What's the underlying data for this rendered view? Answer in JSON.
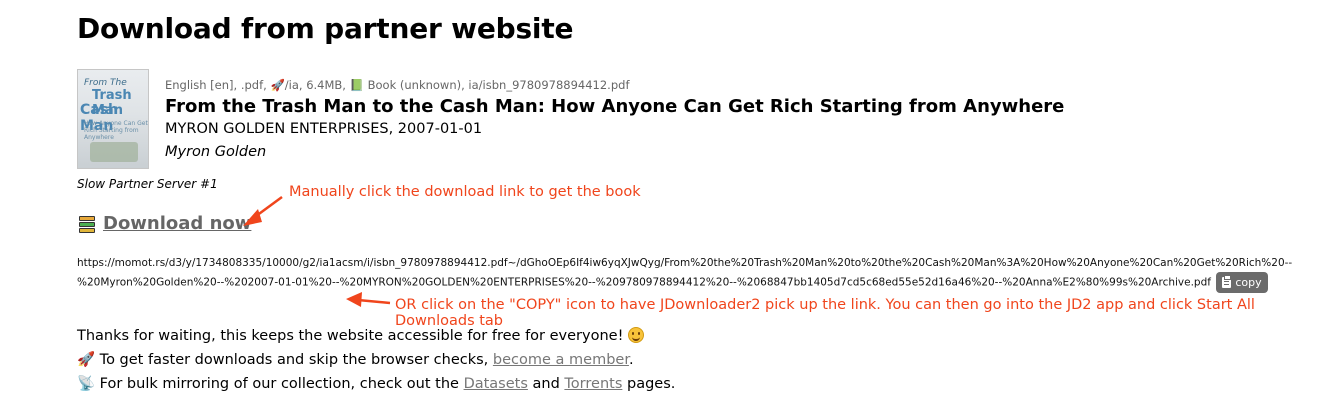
{
  "page": {
    "title": "Download from partner website"
  },
  "book": {
    "cover_line1": "From The",
    "cover_line2": "Trash Man",
    "cover_line3": "Cash Man",
    "cover_line4": "How Anyone Can Get Rich Starting from Anywhere",
    "meta_lang": "English [en], .pdf,",
    "meta_rest": "/ia, 6.4MB,",
    "meta_type": "Book (unknown), ia/isbn_9780978894412.pdf",
    "title": "From the Trash Man to the Cash Man: How Anyone Can Get Rich Starting from Anywhere",
    "publisher": "MYRON GOLDEN ENTERPRISES, 2007-01-01",
    "author": "Myron Golden"
  },
  "server": {
    "label": "Slow Partner Server #1"
  },
  "download": {
    "label": "Download now",
    "url_part1": "https://momot.rs/d3/y/1734808335/10000/g2/ia1acsm/i/isbn_9780978894412.pdf~/dGhoOEp6If4iw6yqXJwQyg/From%20the%20Trash%20Man%20to%20the%20Cash%20Man%3A%20How%20Anyone%20Can%20Get%20Rich%20--%20Myron%20Golden%20--%202007-01-01%20--%20MYRON%20GOLDEN%20ENTERPRISES%20--%209780978894412%20--%2068847bb1405d7cd5c68ed55e52d16a46%20--",
    "url_part2": "%20Anna%E2%80%99s%20Archive.pdf",
    "copy_label": "copy"
  },
  "annotations": {
    "a1": "Manually click the download link to get the book",
    "a2": "OR click on the \"COPY\" icon to have JDownloader2 pick up the link. You can then go into the JD2 app and click Start All Downloads tab",
    "color": "#f0451c"
  },
  "notes": {
    "thanks": "Thanks for waiting, this keeps the website accessible for free for everyone!",
    "faster_pre": "To get faster downloads and skip the browser checks,",
    "faster_link": "become a member",
    "faster_post": ".",
    "bulk_pre": "For bulk mirroring of our collection, check out the",
    "datasets_link": "Datasets",
    "and": "and",
    "torrents_link": "Torrents",
    "bulk_post": "pages."
  }
}
